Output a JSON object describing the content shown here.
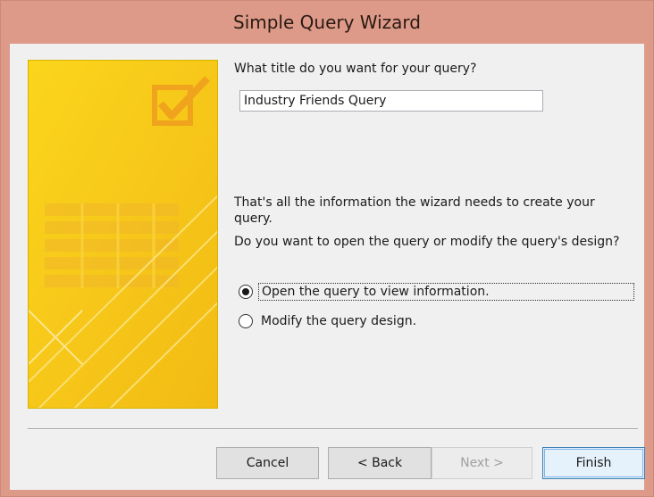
{
  "window": {
    "title": "Simple Query Wizard"
  },
  "wizard": {
    "title_prompt": "What title do you want for your query?",
    "title_value": "Industry Friends Query",
    "info_text": "That's all the information the wizard needs to create your query.",
    "question": "Do you want to open the query or modify the query's design?",
    "options": [
      {
        "label": "Open the query to view information.",
        "selected": true
      },
      {
        "label": "Modify the query design.",
        "selected": false
      }
    ]
  },
  "buttons": {
    "cancel": "Cancel",
    "back": "< Back",
    "next": "Next >",
    "finish": "Finish"
  },
  "colors": {
    "titlebar": "#dd9a88",
    "side_image": "#f5c518",
    "dialog_bg": "#f0f0f0"
  }
}
